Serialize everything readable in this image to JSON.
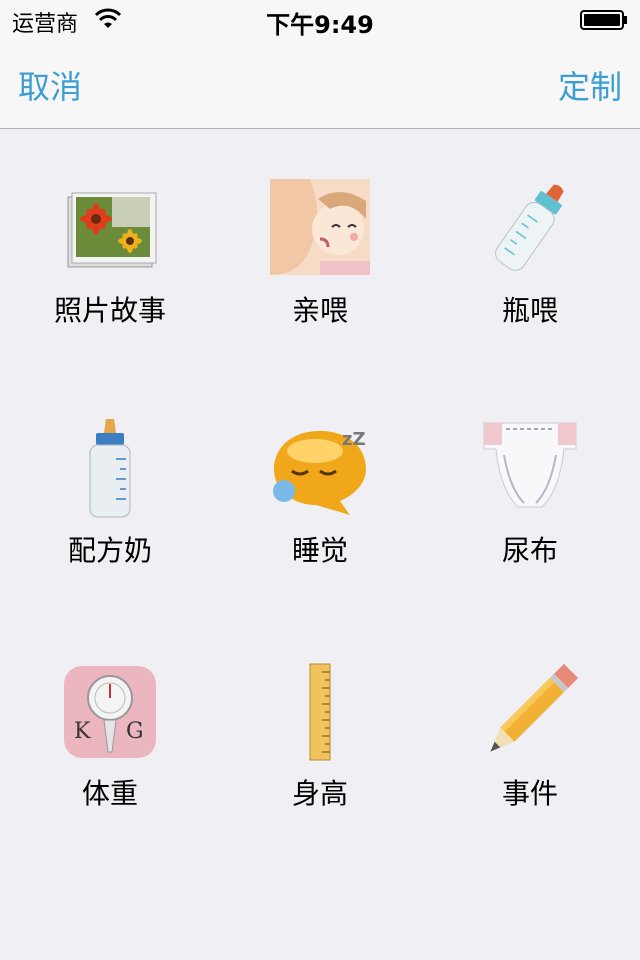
{
  "status_bar": {
    "carrier": "运营商",
    "time": "下午9:49",
    "wifi_icon": "wifi-icon",
    "battery_icon": "battery-icon"
  },
  "nav": {
    "cancel_label": "取消",
    "customize_label": "定制"
  },
  "items": [
    {
      "label": "照片故事",
      "icon": "photo-story-icon"
    },
    {
      "label": "亲喂",
      "icon": "breastfeed-icon"
    },
    {
      "label": "瓶喂",
      "icon": "bottle-feed-icon"
    },
    {
      "label": "配方奶",
      "icon": "formula-bottle-icon"
    },
    {
      "label": "睡觉",
      "icon": "sleep-icon"
    },
    {
      "label": "尿布",
      "icon": "diaper-icon"
    },
    {
      "label": "体重",
      "icon": "scale-icon"
    },
    {
      "label": "身高",
      "icon": "ruler-icon"
    },
    {
      "label": "事件",
      "icon": "pencil-icon"
    }
  ],
  "colors": {
    "accent": "#3d9ed3",
    "background": "#efeff4",
    "bar": "#f7f7f7"
  }
}
